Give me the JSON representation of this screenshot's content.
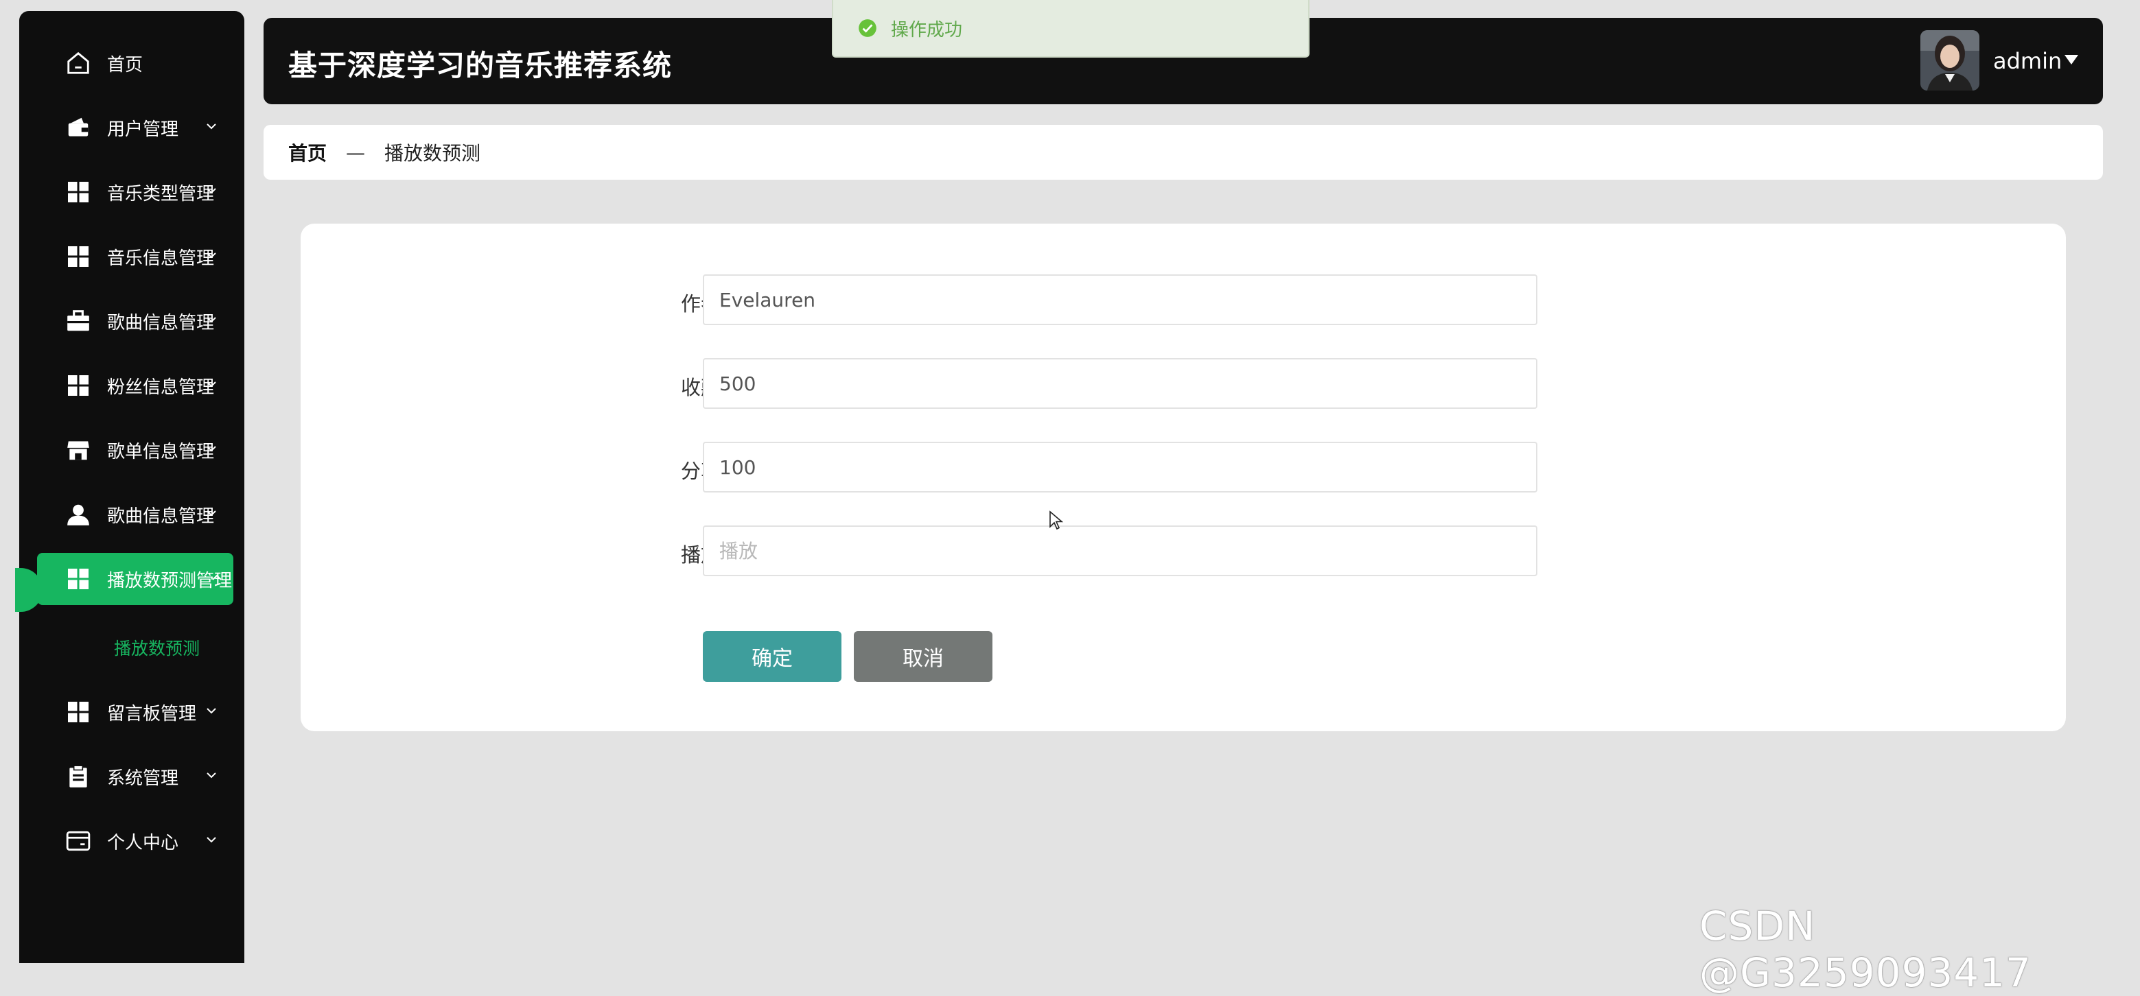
{
  "header": {
    "title": "基于深度学习的音乐推荐系统",
    "user_name": "admin"
  },
  "toast": {
    "text": "操作成功"
  },
  "sidebar": {
    "items": [
      {
        "label": "首页",
        "icon": "home-icon",
        "has_chevron": false
      },
      {
        "label": "用户管理",
        "icon": "wallet-icon",
        "has_chevron": true
      },
      {
        "label": "音乐类型管理",
        "icon": "grid-icon",
        "has_chevron": true
      },
      {
        "label": "音乐信息管理",
        "icon": "grid-icon",
        "has_chevron": true
      },
      {
        "label": "歌曲信息管理",
        "icon": "briefcase-icon",
        "has_chevron": true
      },
      {
        "label": "粉丝信息管理",
        "icon": "grid-icon",
        "has_chevron": true
      },
      {
        "label": "歌单信息管理",
        "icon": "shop-icon",
        "has_chevron": true
      },
      {
        "label": "歌曲信息管理",
        "icon": "user-icon",
        "has_chevron": true
      },
      {
        "label": "播放数预测管理",
        "icon": "grid-icon",
        "has_chevron": true,
        "active": true
      },
      {
        "label": "留言板管理",
        "icon": "grid-icon",
        "has_chevron": true
      },
      {
        "label": "系统管理",
        "icon": "clipboard-icon",
        "has_chevron": true
      },
      {
        "label": "个人中心",
        "icon": "card-icon",
        "has_chevron": true
      }
    ],
    "sub_item": "播放数预测"
  },
  "breadcrumb": {
    "home": "首页",
    "separator": "—",
    "current": "播放数预测"
  },
  "form": {
    "author": {
      "label": "作者",
      "value": "Evelauren"
    },
    "favorites": {
      "label": "收藏",
      "value": "500"
    },
    "shares": {
      "label": "分享",
      "value": "100"
    },
    "plays": {
      "label": "播放",
      "placeholder": "播放",
      "value": ""
    },
    "confirm_label": "确定",
    "cancel_label": "取消"
  },
  "watermark": "CSDN @G3259093417",
  "colors": {
    "accent": "#17b660",
    "confirm": "#3e9e9c",
    "cancel": "#747876",
    "sidebar_bg": "#0e0e0e",
    "header_bg": "#111111",
    "toast_text": "#5fa84a"
  }
}
